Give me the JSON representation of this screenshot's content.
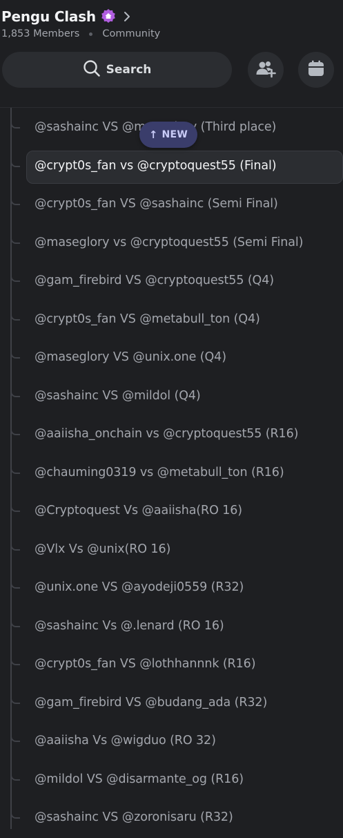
{
  "header": {
    "server_name": "Pengu Clash",
    "members": "1,853 Members",
    "community": "Community",
    "search_label": "Search",
    "boost_color": "#b15ee0"
  },
  "new_pill": {
    "arrow": "↑",
    "label": "NEW"
  },
  "threads": [
    {
      "label": "@sashainc VS @maseglory (Third place)",
      "selected": false
    },
    {
      "label": "@crypt0s_fan vs @cryptoquest55 (Final)",
      "selected": true
    },
    {
      "label": "@crypt0s_fan VS @sashainc (Semi Final)",
      "selected": false
    },
    {
      "label": "@maseglory vs @cryptoquest55 (Semi Final)",
      "selected": false
    },
    {
      "label": "@gam_firebird VS @cryptoquest55 (Q4)",
      "selected": false
    },
    {
      "label": "@crypt0s_fan VS @metabull_ton (Q4)",
      "selected": false
    },
    {
      "label": "@maseglory VS @unix.one (Q4)",
      "selected": false
    },
    {
      "label": "@sashainc VS @mildol (Q4)",
      "selected": false
    },
    {
      "label": "@aaiisha_onchain vs @cryptoquest55 (R16)",
      "selected": false
    },
    {
      "label": "@chauming0319 vs @metabull_ton (R16)",
      "selected": false
    },
    {
      "label": "@Cryptoquest Vs @aaiisha(RO 16)",
      "selected": false
    },
    {
      "label": "@Vlx Vs @unix(RO 16)",
      "selected": false
    },
    {
      "label": "@unix.one VS @ayodeji0559 (R32)",
      "selected": false
    },
    {
      "label": "@sashainc Vs @.lenard (RO 16)",
      "selected": false
    },
    {
      "label": "@crypt0s_fan VS @lothhannnk (R16)",
      "selected": false
    },
    {
      "label": "@gam_firebird VS @budang_ada (R32)",
      "selected": false
    },
    {
      "label": "@aaiisha Vs @wigduo (RO 32)",
      "selected": false
    },
    {
      "label": "@mildol VS @disarmante_og (R16)",
      "selected": false
    },
    {
      "label": "@sashainc VS @zoronisaru (R32)",
      "selected": false
    }
  ],
  "icons": {
    "boost": "boost-home-icon",
    "chevron": "chevron-right-icon",
    "search": "search-icon",
    "invite": "add-member-icon",
    "events": "calendar-icon"
  }
}
